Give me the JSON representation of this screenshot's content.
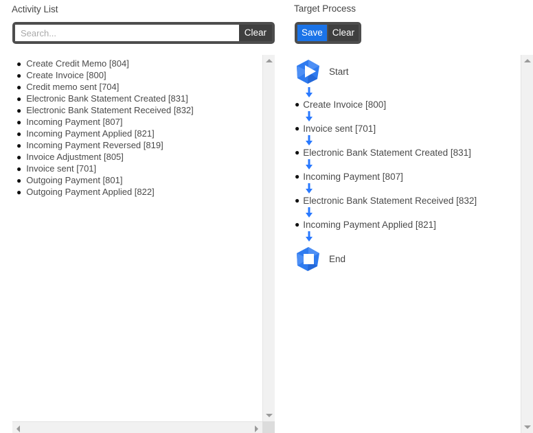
{
  "panels": {
    "activity": {
      "title": "Activity List",
      "search": {
        "placeholder": "Search...",
        "value": "",
        "clear_label": "Clear"
      },
      "items": [
        {
          "label": "Create Credit Memo [804]"
        },
        {
          "label": "Create Invoice [800]"
        },
        {
          "label": "Credit memo sent [704]"
        },
        {
          "label": "Electronic Bank Statement Created [831]"
        },
        {
          "label": "Electronic Bank Statement Received [832]"
        },
        {
          "label": "Incoming Payment [807]"
        },
        {
          "label": "Incoming Payment Applied [821]"
        },
        {
          "label": "Incoming Payment Reversed [819]"
        },
        {
          "label": "Invoice Adjustment [805]"
        },
        {
          "label": "Invoice sent [701]"
        },
        {
          "label": "Outgoing Payment [801]"
        },
        {
          "label": "Outgoing Payment Applied [822]"
        }
      ]
    },
    "target": {
      "title": "Target Process",
      "save_label": "Save",
      "clear_label": "Clear",
      "start_label": "Start",
      "end_label": "End",
      "steps": [
        {
          "label": "Create Invoice [800]"
        },
        {
          "label": "Invoice sent [701]"
        },
        {
          "label": "Electronic Bank Statement Created [831]"
        },
        {
          "label": "Incoming Payment [807]"
        },
        {
          "label": "Electronic Bank Statement Received [832]"
        },
        {
          "label": "Incoming Payment Applied [821]"
        }
      ]
    }
  },
  "icons": {
    "bullet": "●",
    "start": "start-node-icon",
    "end": "end-node-icon",
    "arrow": "down-arrow-icon"
  },
  "colors": {
    "accent_blue": "#1a73e8",
    "node_blue": "#2f7bef",
    "toolbar_dark": "#4d4d4d",
    "button_dark": "#3f3f3f",
    "text_gray": "#4a4a4a",
    "scrollbar_track": "#f1f1f1"
  }
}
